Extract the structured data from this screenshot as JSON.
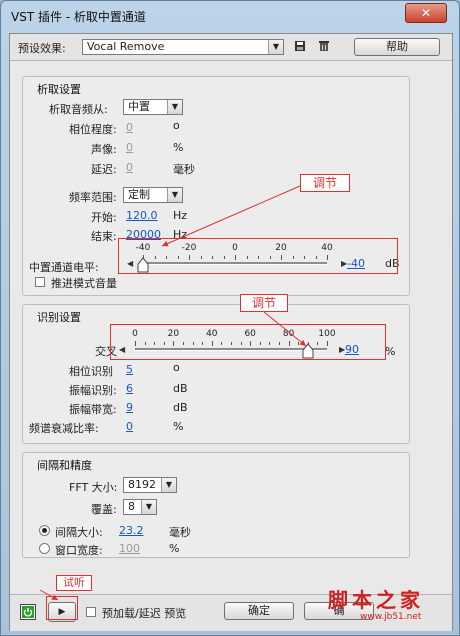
{
  "window": {
    "title": "VST 插件 - 析取中置通道",
    "close_symbol": "✕"
  },
  "toolbar": {
    "preset_label": "预设效果:",
    "preset_value": "Vocal Remove",
    "save_icon": "save-icon",
    "delete_icon": "trash-icon",
    "help_label": "帮助"
  },
  "extract": {
    "title": "析取设置",
    "source_label": "析取音频从:",
    "source_value": "中置",
    "phase_label": "相位程度:",
    "phase_value": "0",
    "phase_unit": "o",
    "pan_label": "声像:",
    "pan_value": "0",
    "pan_unit": "%",
    "delay_label": "延迟:",
    "delay_value": "0",
    "delay_unit": "毫秒",
    "freq_label": "频率范围:",
    "freq_value": "定制",
    "start_label": "开始:",
    "start_value": "120.0",
    "start_unit": "Hz",
    "end_label": "结束:",
    "end_value": "20000",
    "end_unit": "Hz",
    "level_label": "中置通道电平:",
    "level_value": "-40",
    "level_unit": "dB",
    "level_ticks": [
      "-40",
      "-20",
      "0",
      "20",
      "40"
    ],
    "boost_label": "推进模式音量"
  },
  "recog": {
    "title": "识别设置",
    "cross_label": "交叉",
    "cross_value": "90",
    "cross_unit": "%",
    "cross_ticks": [
      "0",
      "20",
      "40",
      "60",
      "80",
      "100"
    ],
    "phase_label": "相位识别",
    "phase_value": "5",
    "phase_unit": "o",
    "amp_label": "振幅识别:",
    "amp_value": "6",
    "amp_unit": "dB",
    "bw_label": "振幅带宽:",
    "bw_value": "9",
    "bw_unit": "dB",
    "ratio_label": "频谱衰减比率:",
    "ratio_value": "0",
    "ratio_unit": "%"
  },
  "spacing": {
    "title": "间隔和精度",
    "fft_label": "FFT 大小:",
    "fft_value": "8192",
    "overlap_label": "覆盖:",
    "overlap_value": "8",
    "interval_label": "间隔大小:",
    "interval_value": "23.2",
    "interval_unit": "毫秒",
    "window_label": "窗口宽度:",
    "window_value": "100",
    "window_unit": "%"
  },
  "annotations": {
    "adjust1": "调节",
    "adjust2": "调节",
    "preview": "试听"
  },
  "bottom": {
    "preload_label": "预加载/延迟 预览",
    "ok_label": "确定",
    "cancel_label": "确"
  },
  "watermark": {
    "text": "脚本之家",
    "url": "www.jb51.net"
  },
  "sliders": {
    "level_fraction": 0.0,
    "cross_fraction": 0.9
  },
  "colors": {
    "link_blue": "#1a56c4",
    "annotation_red": "#e03030",
    "power_green": "#2aa02a"
  }
}
